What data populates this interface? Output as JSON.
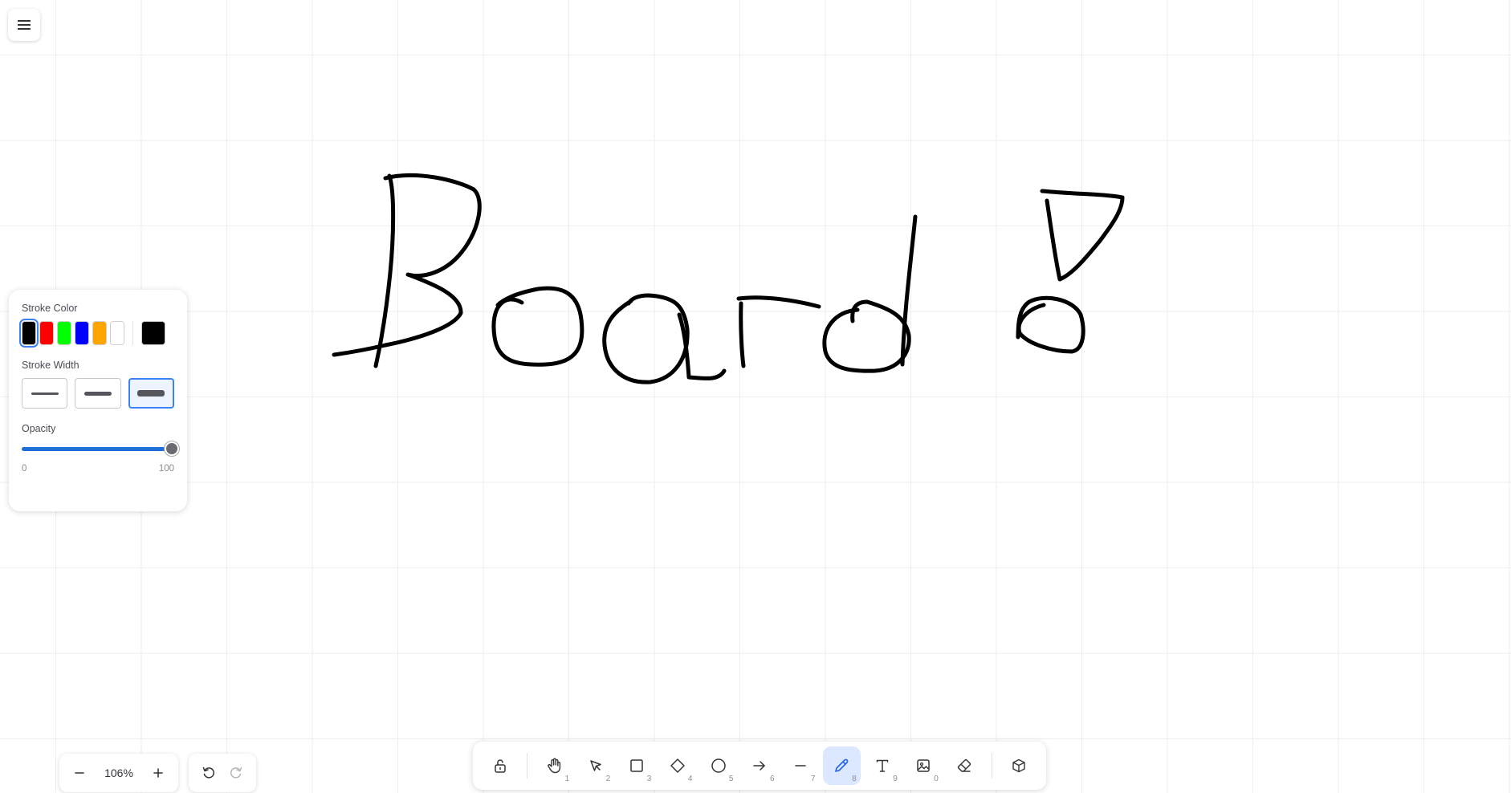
{
  "canvas": {
    "background": "#ffffff",
    "grid_color": "#eeeeee",
    "ink_color": "#000000"
  },
  "menu": {
    "icon": "hamburger-icon"
  },
  "style_panel": {
    "stroke_color_label": "Stroke Color",
    "colors": [
      "#000000",
      "#ff0000",
      "#00ff00",
      "#0000ff",
      "#ffa500",
      "#ffffff"
    ],
    "selected_color": "#000000",
    "current_color": "#000000",
    "stroke_width_label": "Stroke Width",
    "stroke_widths": [
      "thin",
      "medium",
      "thick"
    ],
    "selected_width": "thick",
    "opacity_label": "Opacity",
    "opacity_value": 100,
    "opacity_min": "0",
    "opacity_max": "100"
  },
  "zoom": {
    "zoom_out_icon": "minus-icon",
    "value": "106%",
    "zoom_in_icon": "plus-icon"
  },
  "history": {
    "undo_icon": "undo-icon",
    "redo_icon": "redo-icon",
    "redo_enabled": false
  },
  "toolbar": {
    "accent": "#2563eb",
    "active_bg": "#dbe8ff",
    "tools": [
      {
        "id": "lock",
        "icon": "unlock-icon",
        "key": ""
      },
      {
        "id": "hand",
        "icon": "hand-icon",
        "key": "1"
      },
      {
        "id": "select",
        "icon": "pointer-icon",
        "key": "2"
      },
      {
        "id": "rectangle",
        "icon": "square-icon",
        "key": "3"
      },
      {
        "id": "diamond",
        "icon": "diamond-icon",
        "key": "4"
      },
      {
        "id": "ellipse",
        "icon": "circle-icon",
        "key": "5"
      },
      {
        "id": "arrow",
        "icon": "arrow-right-icon",
        "key": "6"
      },
      {
        "id": "line",
        "icon": "line-icon",
        "key": "7"
      },
      {
        "id": "pencil",
        "icon": "pencil-icon",
        "key": "8",
        "active": true
      },
      {
        "id": "text",
        "icon": "text-icon",
        "key": "9"
      },
      {
        "id": "image",
        "icon": "image-icon",
        "key": "0"
      },
      {
        "id": "eraser",
        "icon": "eraser-icon",
        "key": ""
      },
      {
        "id": "3d",
        "icon": "cube-icon",
        "key": ""
      }
    ]
  }
}
